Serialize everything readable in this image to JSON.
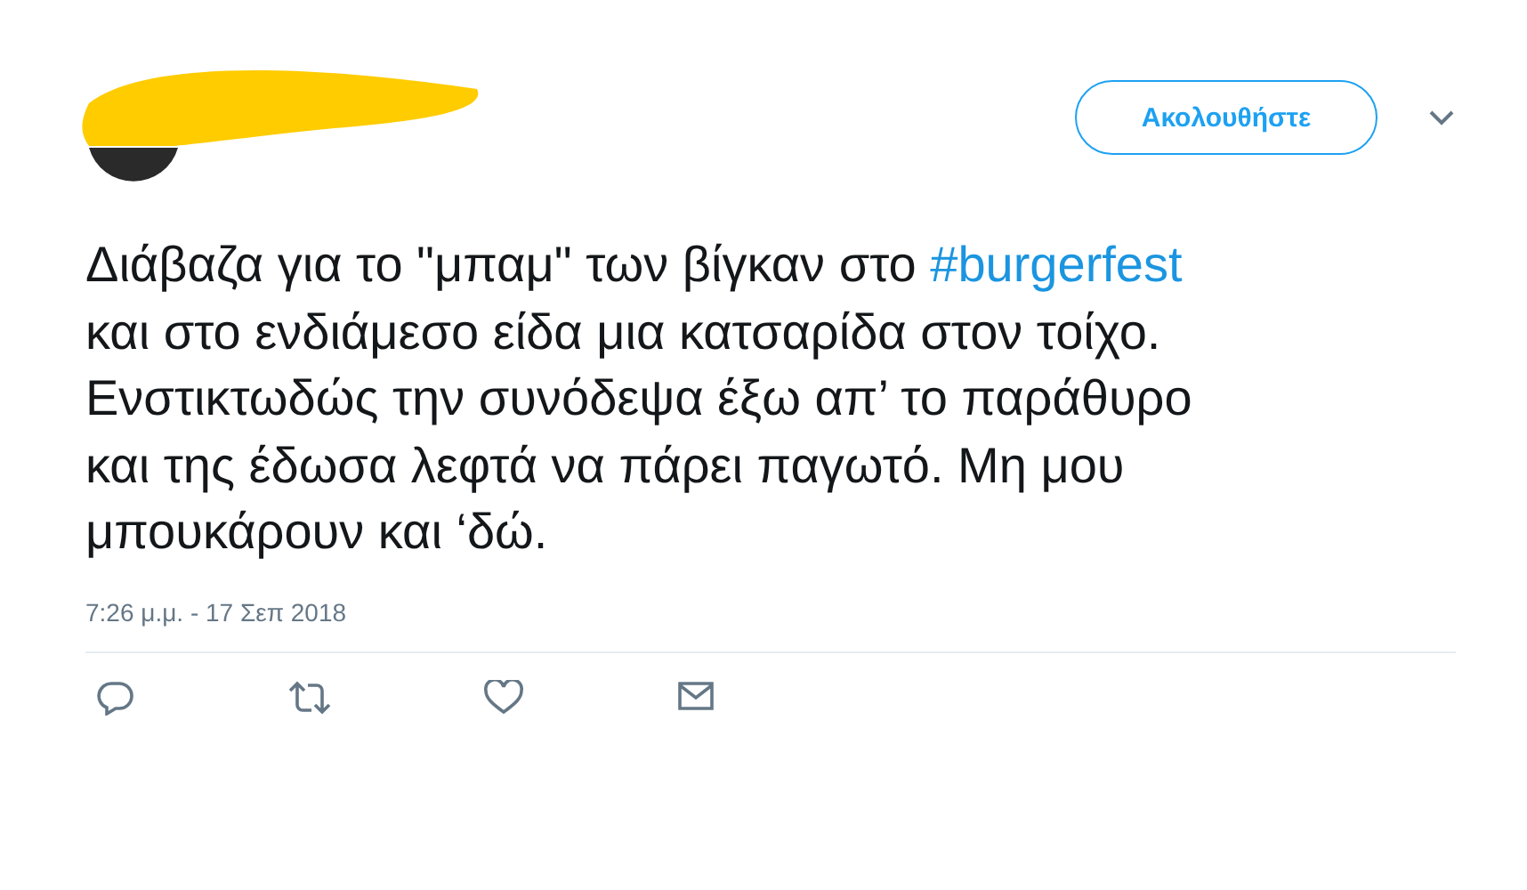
{
  "follow_button": {
    "label": "Ακολουθήστε"
  },
  "tweet": {
    "parts": [
      {
        "kind": "text",
        "text": "Διάβαζα για το \"μπαμ\" των βίγκαν στο "
      },
      {
        "kind": "hashtag",
        "text": "#burgerfest"
      },
      {
        "kind": "text",
        "text": " και στο ενδιάμεσο είδα μια κατσαρίδα στον τοίχο. Ενστικτωδώς την συνόδεψα έξω απ’ το παράθυρο και της έδωσα λεφτά να πάρει παγωτό. Μη μου μπουκάρουν και ‘δώ."
      }
    ]
  },
  "timestamp": "7:26 μ.μ. - 17 Σεπ 2018"
}
